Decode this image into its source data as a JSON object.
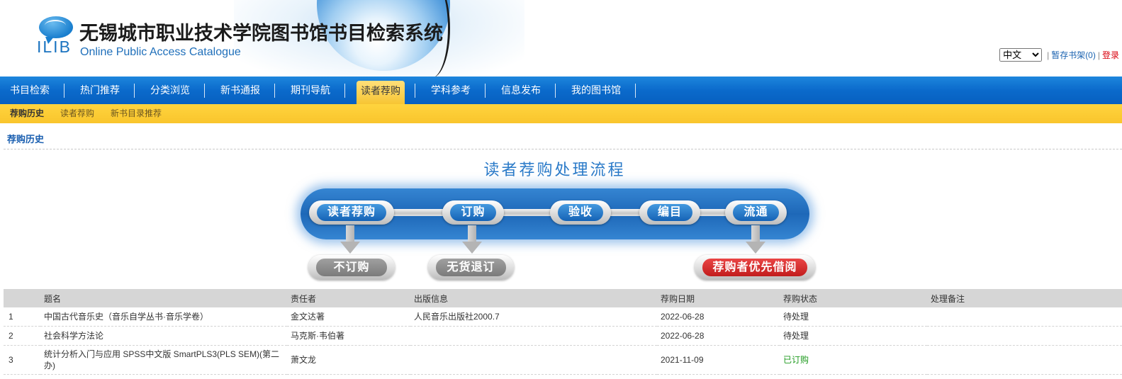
{
  "header": {
    "logo_text": "ILIB",
    "title": "无锡城市职业技术学院图书馆书目检索系统",
    "subtitle": "Online Public Access Catalogue",
    "language": "中文",
    "divider": "|",
    "shelf_link": "暂存书架(0)",
    "login_link": "登录"
  },
  "nav": {
    "items": [
      {
        "label": "书目检索",
        "active": false
      },
      {
        "label": "热门推荐",
        "active": false
      },
      {
        "label": "分类浏览",
        "active": false
      },
      {
        "label": "新书通报",
        "active": false
      },
      {
        "label": "期刊导航",
        "active": false
      },
      {
        "label": "读者荐购",
        "active": true
      },
      {
        "label": "学科参考",
        "active": false
      },
      {
        "label": "信息发布",
        "active": false
      },
      {
        "label": "我的图书馆",
        "active": false
      }
    ]
  },
  "subnav": {
    "items": [
      {
        "label": "荐购历史",
        "active": true
      },
      {
        "label": "读者荐购",
        "active": false
      },
      {
        "label": "新书目录推荐",
        "active": false
      }
    ]
  },
  "breadcrumb": "荐购历史",
  "process": {
    "title": "读者荐购处理流程",
    "steps": [
      "读者荐购",
      "订购",
      "验收",
      "编目",
      "流通"
    ],
    "outcomes": [
      "不订购",
      "无货退订",
      "荐购者优先借阅"
    ]
  },
  "table": {
    "columns": [
      "",
      "题名",
      "责任者",
      "出版信息",
      "荐购日期",
      "荐购状态",
      "处理备注"
    ],
    "rows": [
      {
        "no": "1",
        "title": "中国古代音乐史（音乐自学丛书·音乐学卷）",
        "author": "金文达著",
        "publication": "人民音乐出版社2000.7",
        "date": "2022-06-28",
        "status": "待处理",
        "remark": "",
        "status_color": "#333333"
      },
      {
        "no": "2",
        "title": "社会科学方法论",
        "author": "马克斯·韦伯著",
        "publication": "",
        "date": "2022-06-28",
        "status": "待处理",
        "remark": "",
        "status_color": "#333333"
      },
      {
        "no": "3",
        "title": "统计分析入门与应用 SPSS中文版 SmartPLS3(PLS SEM)(第二办)",
        "author": "萧文龙",
        "publication": "",
        "date": "2021-11-09",
        "status": "已订购",
        "remark": "",
        "status_color": "#1e9a1e"
      }
    ]
  },
  "colors": {
    "nav_blue": "#0b6acb",
    "accent_yellow": "#fcc930",
    "link_blue": "#1a62b0",
    "login_red": "#d9000d",
    "title_blue": "#2a7ac8"
  }
}
